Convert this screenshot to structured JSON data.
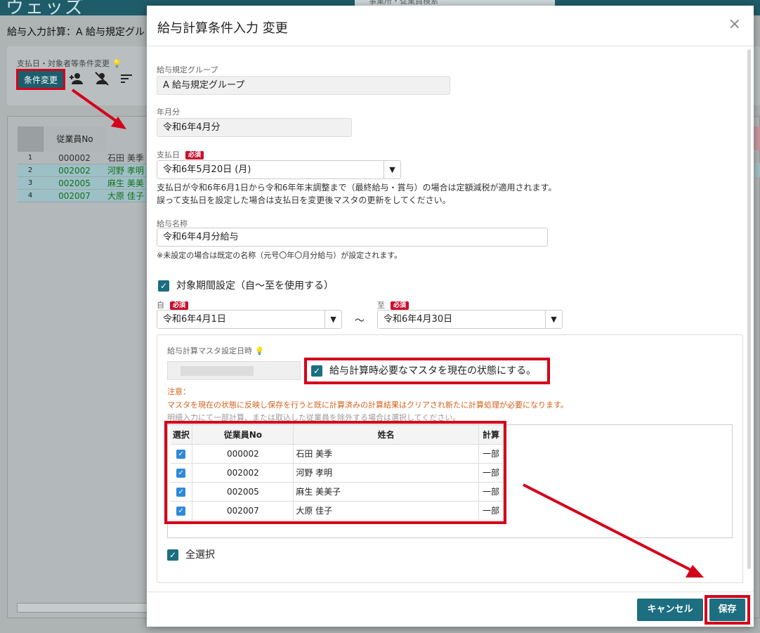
{
  "app": {
    "logo_text": "ウェッズ",
    "search_placeholder": "事業所・従業員検索",
    "page_title": "給与入力計算：A 給与規定グル",
    "panel_label": "支払日・対象者等条件変更",
    "condition_button": "条件変更",
    "grid": {
      "header_no": "従業員No",
      "rows": [
        {
          "rn": "1",
          "no": "000002",
          "name": "石田 美季"
        },
        {
          "rn": "2",
          "no": "002002",
          "name": "河野 孝明"
        },
        {
          "rn": "3",
          "no": "002005",
          "name": "麻生 美美子"
        },
        {
          "rn": "4",
          "no": "002007",
          "name": "大原 佳子"
        }
      ]
    }
  },
  "modal": {
    "title": "給与計算条件入力 変更",
    "close_icon": "×",
    "required_label": "必須",
    "group_label": "給与規定グループ",
    "group_value": "A 給与規定グループ",
    "yearmonth_label": "年月分",
    "yearmonth_value": "令和6年4月分",
    "paydate_label": "支払日",
    "paydate_value": "令和6年5月20日 (月)",
    "paydate_note1": "支払日が令和6年6月1日から令和6年年末調整まで（最終給与・賞与）の場合は定額減税が適用されます。",
    "paydate_note2": "誤って支払日を設定した場合は支払日を変更後マスタの更新をしてください。",
    "payname_label": "給与名称",
    "payname_value": "令和6年4月分給与",
    "payname_note": "※未設定の場合は既定の名称（元号〇年〇月分給与）が設定されます。",
    "period_check_label": "対象期間設定（自～至を使用する）",
    "from_label": "自",
    "from_value": "令和6年4月1日",
    "tilde": "～",
    "to_label": "至",
    "to_value": "令和6年4月30日",
    "master_label": "給与計算マスタ設定日時",
    "master_check_label": "給与計算時必要なマスタを現在の状態にする。",
    "caution_title": "注意：",
    "caution_text": "マスタを現在の状態に反映し保存を行うと既に計算済みの計算結果はクリアされ新たに計算処理が必要になります。",
    "caution_text2": "明細入力にて一部計算、または取込した従業員を除外する場合は選択してください。",
    "table": {
      "headers": [
        "選択",
        "従業員No",
        "姓名",
        "計算"
      ],
      "rows": [
        {
          "no": "000002",
          "name": "石田 美季",
          "calc": "一部"
        },
        {
          "no": "002002",
          "name": "河野 孝明",
          "calc": "一部"
        },
        {
          "no": "002005",
          "name": "麻生 美美子",
          "calc": "一部"
        },
        {
          "no": "002007",
          "name": "大原 佳子",
          "calc": "一部"
        }
      ]
    },
    "select_all_label": "全選択",
    "cancel_button": "キャンセル",
    "save_button": "保存"
  },
  "colors": {
    "accent": "#1c6e80",
    "highlight_red": "#d4001a",
    "required_badge": "#c8102e",
    "warning_text": "#d26018"
  }
}
